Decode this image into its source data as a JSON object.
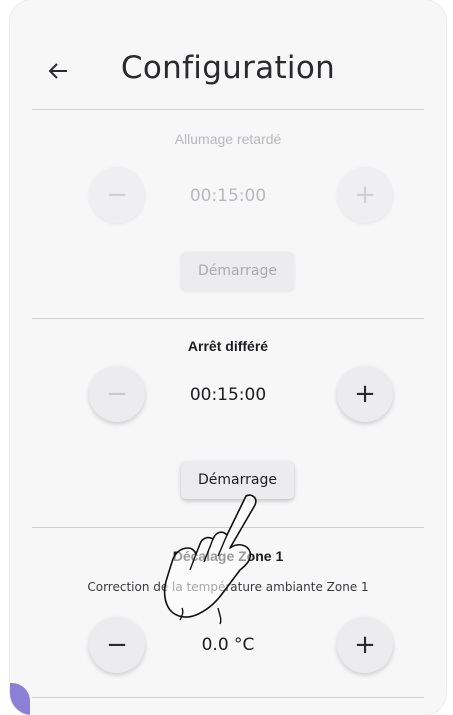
{
  "header": {
    "back_icon": "arrow-left-icon",
    "title": "Configuration"
  },
  "sections": {
    "delayed_on": {
      "title": "Allumage retardé",
      "value": "00:15:00",
      "minus_label": "−",
      "plus_label": "+",
      "button_label": "Démarrage",
      "state": "disabled"
    },
    "delayed_off": {
      "title": "Arrêt différé",
      "value": "00:15:00",
      "minus_label": "−",
      "plus_label": "+",
      "button_label": "Démarrage",
      "state": "enabled"
    },
    "offset_zone1": {
      "title_visible_part": "Zone 1",
      "title_prefix_visible": "Décalage",
      "subtitle": "Correction de la température ambiante Zone 1",
      "value": "0.0 °C",
      "minus_label": "−",
      "plus_label": "+",
      "state": "enabled"
    }
  },
  "overlay": {
    "hand_icon": "pointing-hand-icon"
  },
  "colors": {
    "background": "#f7f7f8",
    "divider": "#cfcfd2",
    "accent": "#8b7fd6"
  }
}
